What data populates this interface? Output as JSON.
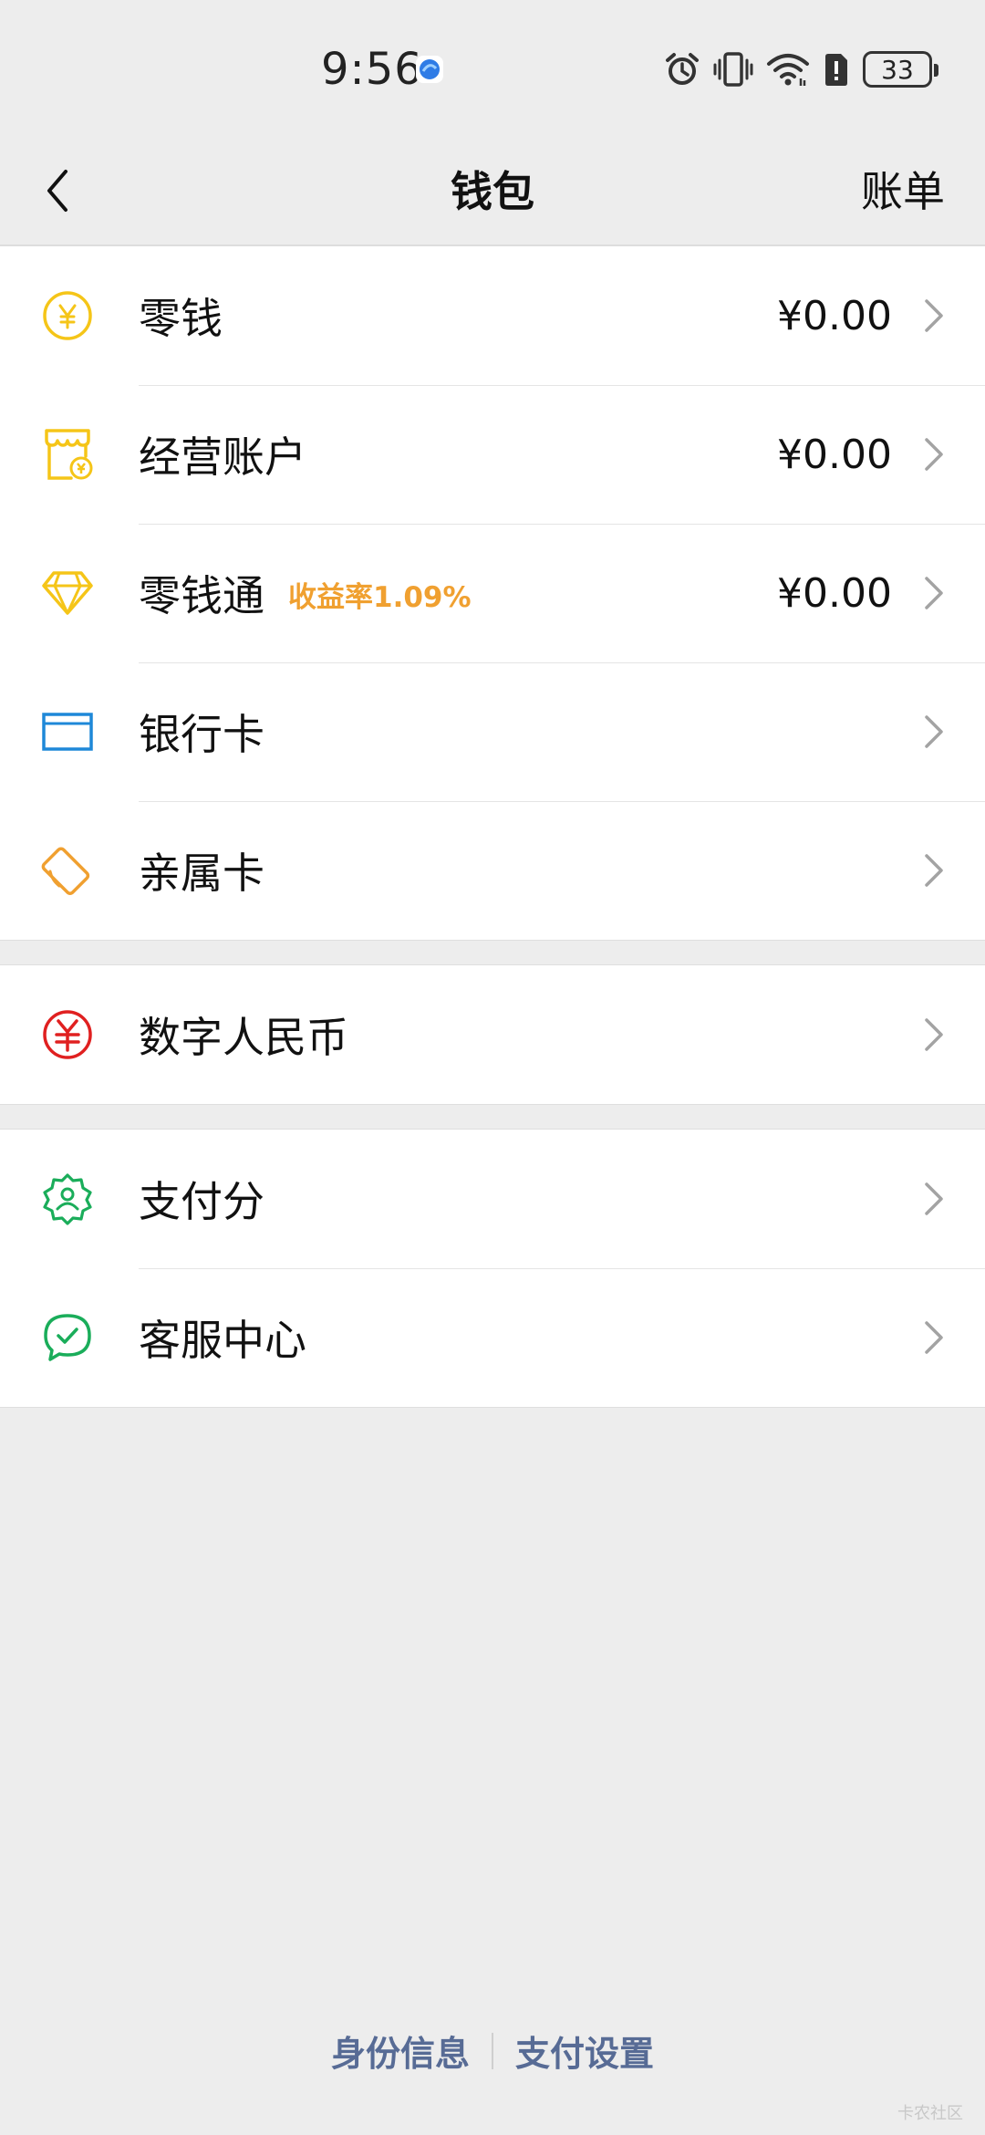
{
  "status_bar": {
    "time": "9:56",
    "battery": "33"
  },
  "nav": {
    "title": "钱包",
    "right_label": "账单"
  },
  "groups": [
    {
      "items": [
        {
          "icon": "yuan-coin-icon",
          "label": "零钱",
          "value": "¥0.00"
        },
        {
          "icon": "store-icon",
          "label": "经营账户",
          "value": "¥0.00"
        },
        {
          "icon": "diamond-icon",
          "label": "零钱通",
          "tag": "收益率1.09%",
          "value": "¥0.00"
        },
        {
          "icon": "bank-card-icon",
          "label": "银行卡",
          "value": ""
        },
        {
          "icon": "family-card-icon",
          "label": "亲属卡",
          "value": ""
        }
      ]
    },
    {
      "items": [
        {
          "icon": "digital-rmb-icon",
          "label": "数字人民币",
          "value": ""
        }
      ]
    },
    {
      "items": [
        {
          "icon": "pay-score-icon",
          "label": "支付分",
          "value": ""
        },
        {
          "icon": "customer-service-icon",
          "label": "客服中心",
          "value": ""
        }
      ]
    }
  ],
  "footer": {
    "left": "身份信息",
    "right": "支付设置"
  },
  "watermark": "卡农社区",
  "colors": {
    "background": "#ededed",
    "yellow": "#f5c518",
    "orange": "#f0a030",
    "blue": "#1e88d8",
    "red": "#e02020",
    "green": "#1aad5a",
    "link": "#576b95"
  }
}
